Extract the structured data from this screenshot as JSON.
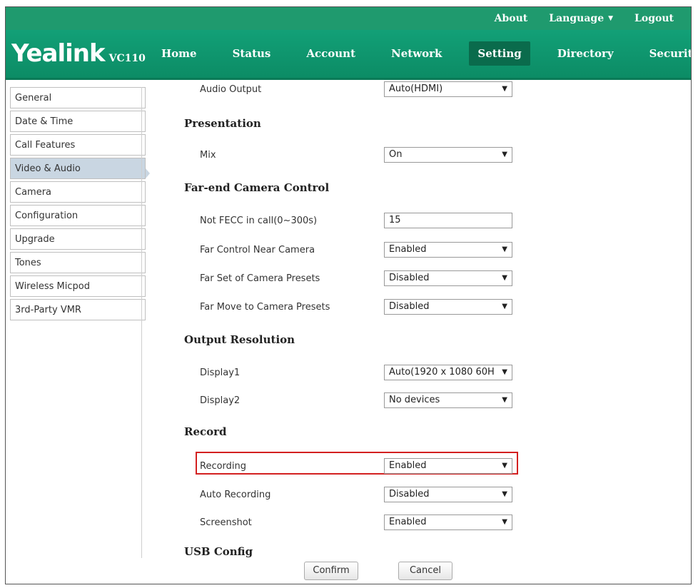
{
  "top_links": {
    "about": "About",
    "language": "Language",
    "logout": "Logout"
  },
  "brand": {
    "name": "Yealink",
    "model": "VC110",
    "accent": "#1f9a6e"
  },
  "nav": [
    "Home",
    "Status",
    "Account",
    "Network",
    "Setting",
    "Directory",
    "Security"
  ],
  "nav_active": "Setting",
  "sidebar": [
    "General",
    "Date & Time",
    "Call Features",
    "Video & Audio",
    "Camera",
    "Configuration",
    "Upgrade",
    "Tones",
    "Wireless Micpod",
    "3rd-Party VMR"
  ],
  "sidebar_active": "Video & Audio",
  "form": {
    "audio_output": {
      "label": "Audio Output",
      "value": "Auto(HDMI)"
    },
    "presentation": {
      "title": "Presentation",
      "mix": {
        "label": "Mix",
        "value": "On"
      }
    },
    "fecc": {
      "title": "Far-end Camera Control",
      "not_fecc": {
        "label": "Not FECC in call(0~300s)",
        "value": "15"
      },
      "far_control": {
        "label": "Far Control Near Camera",
        "value": "Enabled"
      },
      "far_set": {
        "label": "Far Set of Camera Presets",
        "value": "Disabled"
      },
      "far_move": {
        "label": "Far Move to Camera Presets",
        "value": "Disabled"
      }
    },
    "output_resolution": {
      "title": "Output Resolution",
      "display1": {
        "label": "Display1",
        "value": "Auto(1920 x 1080 60H"
      },
      "display2": {
        "label": "Display2",
        "value": "No devices"
      }
    },
    "record": {
      "title": "Record",
      "recording": {
        "label": "Recording",
        "value": "Enabled"
      },
      "auto_recording": {
        "label": "Auto Recording",
        "value": "Disabled"
      },
      "screenshot": {
        "label": "Screenshot",
        "value": "Enabled"
      }
    },
    "next_section_partial": "USB Config"
  },
  "buttons": {
    "confirm": "Confirm",
    "cancel": "Cancel"
  }
}
